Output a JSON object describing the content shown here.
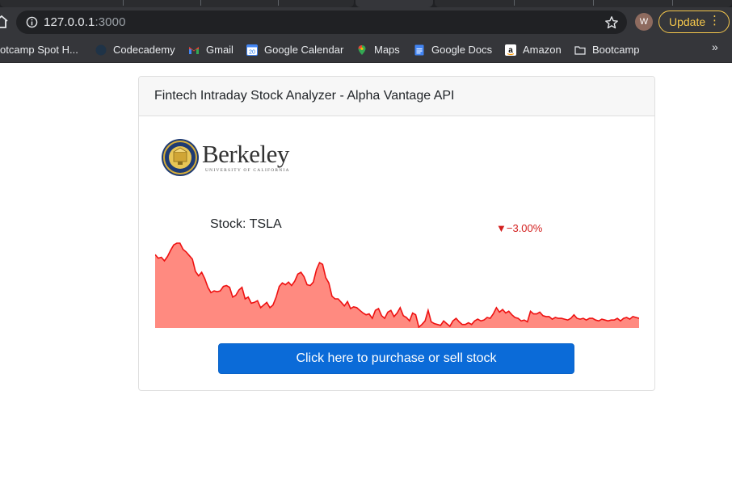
{
  "browser": {
    "url_host": "127.0.0.1",
    "url_port": ":3000",
    "avatar_initial": "W",
    "update_label": "Update",
    "bookmarks": [
      {
        "label": "otcamp Spot H...",
        "icon": "bootcamp-icon"
      },
      {
        "label": "Codecademy",
        "icon": "codecademy-icon"
      },
      {
        "label": "Gmail",
        "icon": "gmail-icon"
      },
      {
        "label": "Google Calendar",
        "icon": "calendar-icon"
      },
      {
        "label": "Maps",
        "icon": "maps-icon"
      },
      {
        "label": "Google Docs",
        "icon": "docs-icon"
      },
      {
        "label": "Amazon",
        "icon": "amazon-icon"
      },
      {
        "label": "Bootcamp",
        "icon": "folder-icon"
      }
    ],
    "more_label": "»"
  },
  "card": {
    "title": "Fintech Intraday Stock Analyzer - Alpha Vantage API",
    "logo_word": "Berkeley",
    "logo_subtitle": "UNIVERSITY OF CALIFORNIA"
  },
  "stock": {
    "label": "Stock: TSLA",
    "change": "▼−3.00%",
    "fill_color": "#ff8a80",
    "line_color": "#ee1111",
    "series": [
      84,
      80,
      81,
      77,
      82,
      89,
      95,
      97,
      97,
      90,
      87,
      83,
      79,
      65,
      60,
      64,
      57,
      47,
      41,
      43,
      42,
      43,
      48,
      49,
      47,
      36,
      38,
      44,
      47,
      34,
      36,
      29,
      30,
      32,
      24,
      27,
      30,
      24,
      27,
      36,
      48,
      52,
      50,
      53,
      49,
      54,
      62,
      64,
      59,
      50,
      49,
      53,
      67,
      75,
      73,
      58,
      52,
      37,
      34,
      34,
      30,
      26,
      31,
      23,
      25,
      24,
      21,
      18,
      16,
      17,
      12,
      21,
      23,
      15,
      12,
      19,
      21,
      14,
      18,
      24,
      15,
      13,
      9,
      18,
      16,
      2,
      5,
      9,
      21,
      8,
      6,
      5,
      4,
      9,
      6,
      3,
      9,
      12,
      8,
      5,
      5,
      7,
      5,
      9,
      11,
      9,
      10,
      13,
      12,
      17,
      24,
      19,
      22,
      18,
      20,
      16,
      13,
      12,
      9,
      10,
      8,
      20,
      17,
      17,
      19,
      15,
      14,
      14,
      11,
      13,
      12,
      12,
      11,
      10,
      12,
      16,
      12,
      11,
      12,
      10,
      12,
      12,
      10,
      9,
      11,
      10,
      9,
      10,
      10,
      12,
      9,
      12,
      13,
      11,
      14,
      13,
      12
    ]
  },
  "action_label": "Click here to purchase or sell stock"
}
